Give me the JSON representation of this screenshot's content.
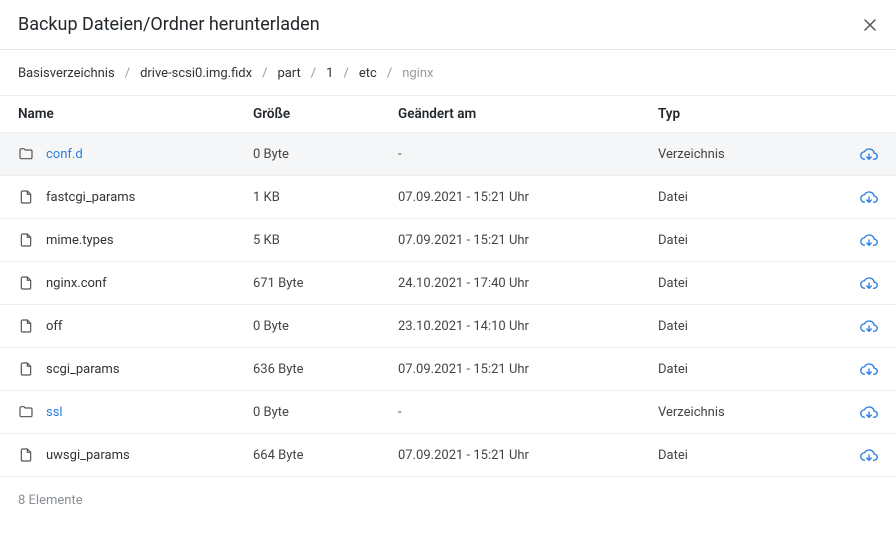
{
  "dialog": {
    "title": "Backup Dateien/Ordner herunterladen"
  },
  "breadcrumb": {
    "items": [
      {
        "label": "Basisverzeichnis",
        "current": false
      },
      {
        "label": "drive-scsi0.img.fidx",
        "current": false
      },
      {
        "label": "part",
        "current": false
      },
      {
        "label": "1",
        "current": false
      },
      {
        "label": "etc",
        "current": false
      },
      {
        "label": "nginx",
        "current": true
      }
    ]
  },
  "table": {
    "headers": {
      "name": "Name",
      "size": "Größe",
      "modified": "Geändert am",
      "type": "Typ"
    },
    "rows": [
      {
        "icon": "folder",
        "name": "conf.d",
        "is_folder": true,
        "size": "0 Byte",
        "modified": "-",
        "type": "Verzeichnis",
        "selected": true
      },
      {
        "icon": "file",
        "name": "fastcgi_params",
        "is_folder": false,
        "size": "1 KB",
        "modified": "07.09.2021 - 15:21 Uhr",
        "type": "Datei",
        "selected": false
      },
      {
        "icon": "file",
        "name": "mime.types",
        "is_folder": false,
        "size": "5 KB",
        "modified": "07.09.2021 - 15:21 Uhr",
        "type": "Datei",
        "selected": false
      },
      {
        "icon": "file",
        "name": "nginx.conf",
        "is_folder": false,
        "size": "671 Byte",
        "modified": "24.10.2021 - 17:40 Uhr",
        "type": "Datei",
        "selected": false
      },
      {
        "icon": "file",
        "name": "off",
        "is_folder": false,
        "size": "0 Byte",
        "modified": "23.10.2021 - 14:10 Uhr",
        "type": "Datei",
        "selected": false
      },
      {
        "icon": "file",
        "name": "scgi_params",
        "is_folder": false,
        "size": "636 Byte",
        "modified": "07.09.2021 - 15:21 Uhr",
        "type": "Datei",
        "selected": false
      },
      {
        "icon": "folder",
        "name": "ssl",
        "is_folder": true,
        "size": "0 Byte",
        "modified": "-",
        "type": "Verzeichnis",
        "selected": false
      },
      {
        "icon": "file",
        "name": "uwsgi_params",
        "is_folder": false,
        "size": "664 Byte",
        "modified": "07.09.2021 - 15:21 Uhr",
        "type": "Datei",
        "selected": false
      }
    ]
  },
  "footer": {
    "count_text": "8 Elemente"
  }
}
